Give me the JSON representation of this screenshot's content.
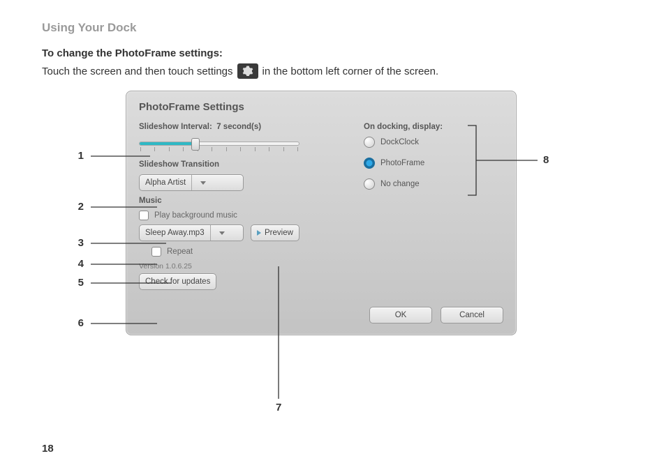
{
  "page": {
    "section_title": "Using Your Dock",
    "step_title": "To change the PhotoFrame settings:",
    "step_text_before": "Touch the screen and then touch settings",
    "step_text_after": "in the bottom left corner of the screen.",
    "page_number": "18"
  },
  "dialog": {
    "title": "PhotoFrame Settings",
    "interval_label": "Slideshow Interval:",
    "interval_value": "7 second(s)",
    "slider_percent": 35,
    "transition_label": "Slideshow Transition",
    "transition_value": "Alpha Artist",
    "music_label": "Music",
    "check_play": "Play background music",
    "music_file": "Sleep Away.mp3",
    "preview": "Preview",
    "check_repeat": "Repeat",
    "version_text": "Version 1.0.6.25",
    "update_btn": "Check for updates",
    "docking_label": "On docking, display:",
    "radios": [
      {
        "label": "DockClock",
        "selected": false
      },
      {
        "label": "PhotoFrame",
        "selected": true
      },
      {
        "label": "No change",
        "selected": false
      }
    ],
    "ok": "OK",
    "cancel": "Cancel"
  },
  "callouts": {
    "n1": "1",
    "n2": "2",
    "n3": "3",
    "n4": "4",
    "n5": "5",
    "n6": "6",
    "n7": "7",
    "n8": "8"
  }
}
